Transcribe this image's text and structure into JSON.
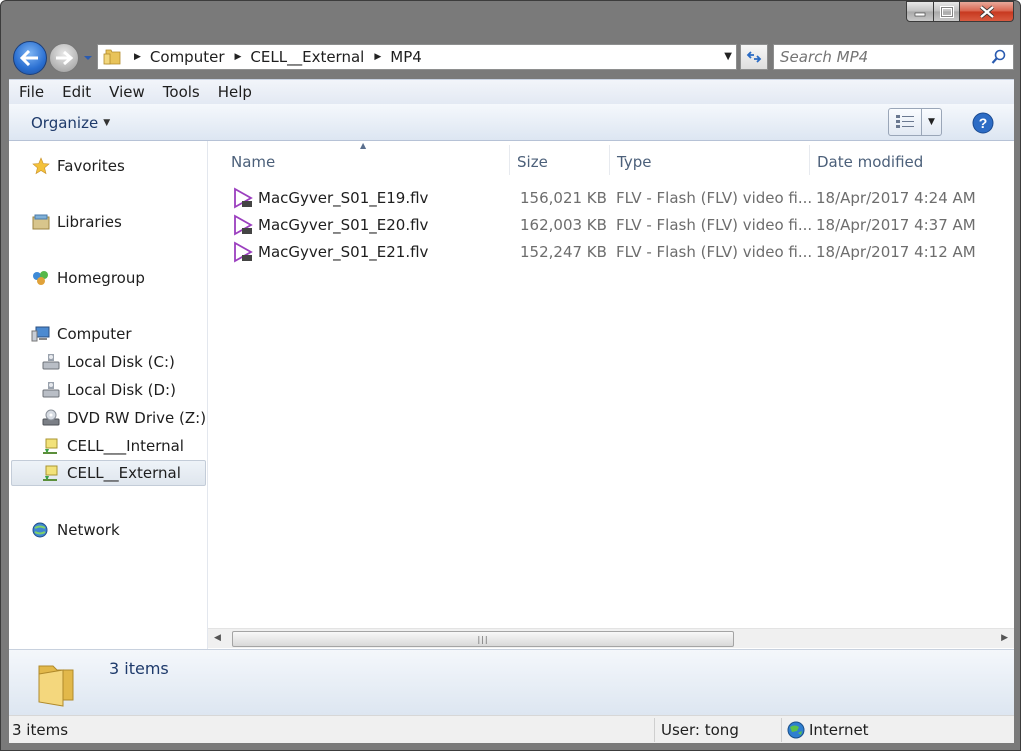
{
  "window": {
    "controls": [
      "minimize",
      "maximize",
      "close"
    ]
  },
  "address": {
    "breadcrumbs": [
      "Computer",
      "CELL__External",
      "MP4"
    ],
    "search_placeholder": "Search MP4"
  },
  "menu": [
    "File",
    "Edit",
    "View",
    "Tools",
    "Help"
  ],
  "commandbar": {
    "organize_label": "Organize"
  },
  "navpane": {
    "items": [
      {
        "label": "Favorites",
        "icon": "star-icon"
      },
      {
        "label": "Libraries",
        "icon": "libraries-icon"
      },
      {
        "label": "Homegroup",
        "icon": "homegroup-icon"
      },
      {
        "label": "Computer",
        "icon": "computer-icon"
      },
      {
        "label": "Local Disk (C:)",
        "icon": "hard-disk-icon"
      },
      {
        "label": "Local Disk (D:)",
        "icon": "hard-disk-icon"
      },
      {
        "label": "DVD RW Drive (Z:)",
        "icon": "dvd-drive-icon"
      },
      {
        "label": "CELL___Internal",
        "icon": "network-drive-icon"
      },
      {
        "label": "CELL__External",
        "icon": "network-drive-icon",
        "selected": true
      },
      {
        "label": "Network",
        "icon": "network-icon"
      }
    ]
  },
  "filelist": {
    "columns": [
      "Name",
      "Size",
      "Type",
      "Date modified"
    ],
    "sorted_by": "Name",
    "rows": [
      {
        "name": "MacGyver_S01_E19.flv",
        "size": "156,021 KB",
        "type": "FLV - Flash (FLV) video fi...",
        "date": "18/Apr/2017 4:24 AM"
      },
      {
        "name": "MacGyver_S01_E20.flv",
        "size": "162,003 KB",
        "type": "FLV - Flash (FLV) video fi...",
        "date": "18/Apr/2017 4:37 AM"
      },
      {
        "name": "MacGyver_S01_E21.flv",
        "size": "152,247 KB",
        "type": "FLV - Flash (FLV) video fi...",
        "date": "18/Apr/2017 4:12 AM"
      }
    ]
  },
  "details": {
    "text": "3 items"
  },
  "status": {
    "count": "3 items",
    "user": "User: tong",
    "zone": "Internet"
  },
  "colors": {
    "accent": "#1e3a6b",
    "header_text": "#4c607a",
    "flv_icon": "#9b3fbf"
  }
}
